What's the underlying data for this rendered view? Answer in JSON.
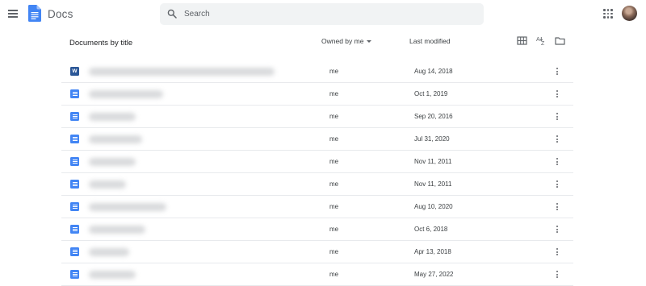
{
  "header": {
    "app_name": "Docs",
    "search_placeholder": "Search"
  },
  "toolbar": {
    "list_title": "Documents by title",
    "owner_filter": "Owned by me",
    "sort_label": "Last modified"
  },
  "documents": [
    {
      "type": "word",
      "type_label": "W",
      "owner": "me",
      "modified": "Aug 14, 2018"
    },
    {
      "type": "doc",
      "owner": "me",
      "modified": "Oct 1, 2019"
    },
    {
      "type": "doc",
      "owner": "me",
      "modified": "Sep 20, 2016"
    },
    {
      "type": "doc",
      "owner": "me",
      "modified": "Jul 31, 2020"
    },
    {
      "type": "doc",
      "owner": "me",
      "modified": "Nov 11, 2011"
    },
    {
      "type": "doc",
      "owner": "me",
      "modified": "Nov 11, 2011"
    },
    {
      "type": "doc",
      "owner": "me",
      "modified": "Aug 10, 2020"
    },
    {
      "type": "doc",
      "owner": "me",
      "modified": "Oct 6, 2018"
    },
    {
      "type": "doc",
      "owner": "me",
      "modified": "Apr 13, 2018"
    },
    {
      "type": "doc",
      "owner": "me",
      "modified": "May 27, 2022"
    }
  ],
  "icons": {
    "menu": "hamburger-menu-icon",
    "logo": "docs-logo-icon",
    "search": "search-icon",
    "apps": "apps-grid-icon",
    "view": "grid-view-icon",
    "sort": "sort-az-icon",
    "folder": "folder-icon",
    "more": "more-vert-icon"
  },
  "colors": {
    "docs_blue": "#4285f4",
    "word_blue": "#2b5797",
    "search_bg": "#f1f3f4",
    "divider": "#e8eaed"
  }
}
